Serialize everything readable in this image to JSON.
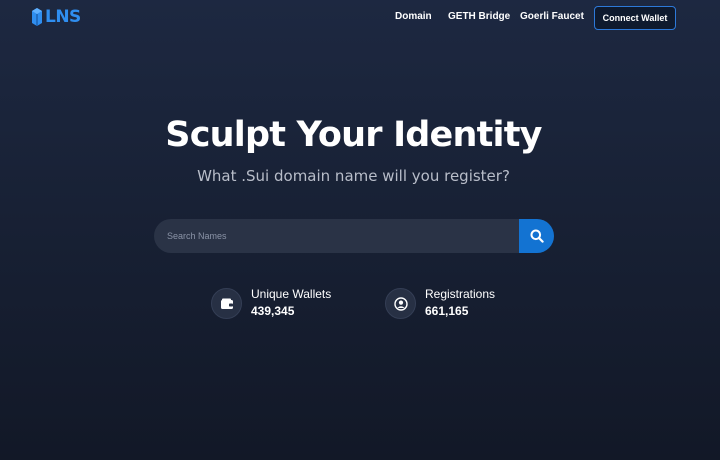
{
  "brand": {
    "name": "LNS",
    "color": "#2f8ef0"
  },
  "nav": {
    "links": [
      "Domain",
      "GETH Bridge",
      "Goerli Faucet"
    ],
    "connect_label": "Connect Wallet"
  },
  "hero": {
    "title": "Sculpt Your Identity",
    "subtitle": "What .Sui domain name will you register?"
  },
  "search": {
    "placeholder": "Search Names",
    "value": "",
    "button_icon": "search-icon",
    "button_color": "#1373d2"
  },
  "stats": [
    {
      "label": "Unique Wallets",
      "value": "439,345",
      "icon": "wallet-icon"
    },
    {
      "label": "Registrations",
      "value": "661,165",
      "icon": "user-circle-icon"
    }
  ]
}
